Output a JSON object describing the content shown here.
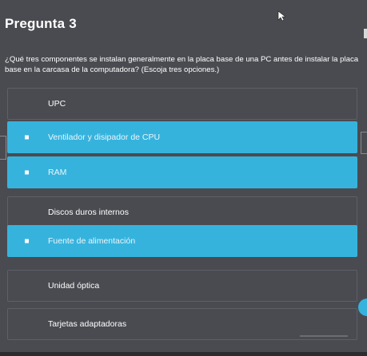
{
  "question": {
    "title": "Pregunta 3",
    "text": "¿Qué tres componentes se instalan generalmente en la placa base de una PC antes de instalar la placa base en la carcasa de la computadora? (Escoja tres opciones.)"
  },
  "options": [
    {
      "label": "UPC",
      "selected": false
    },
    {
      "label": "Ventilador y disipador de CPU",
      "selected": true
    },
    {
      "label": "RAM",
      "selected": true
    },
    {
      "label": "Discos duros internos",
      "selected": false
    },
    {
      "label": "Fuente de alimentación",
      "selected": true
    },
    {
      "label": "Unidad óptica",
      "selected": false
    },
    {
      "label": "Tarjetas adaptadoras",
      "selected": false
    }
  ],
  "colors": {
    "background": "#4a4b51",
    "selected": "#36b3dd",
    "text": "#ffffff"
  },
  "icons": {
    "cursor": "mouse-pointer-icon",
    "check": "checkbox-square-icon"
  }
}
